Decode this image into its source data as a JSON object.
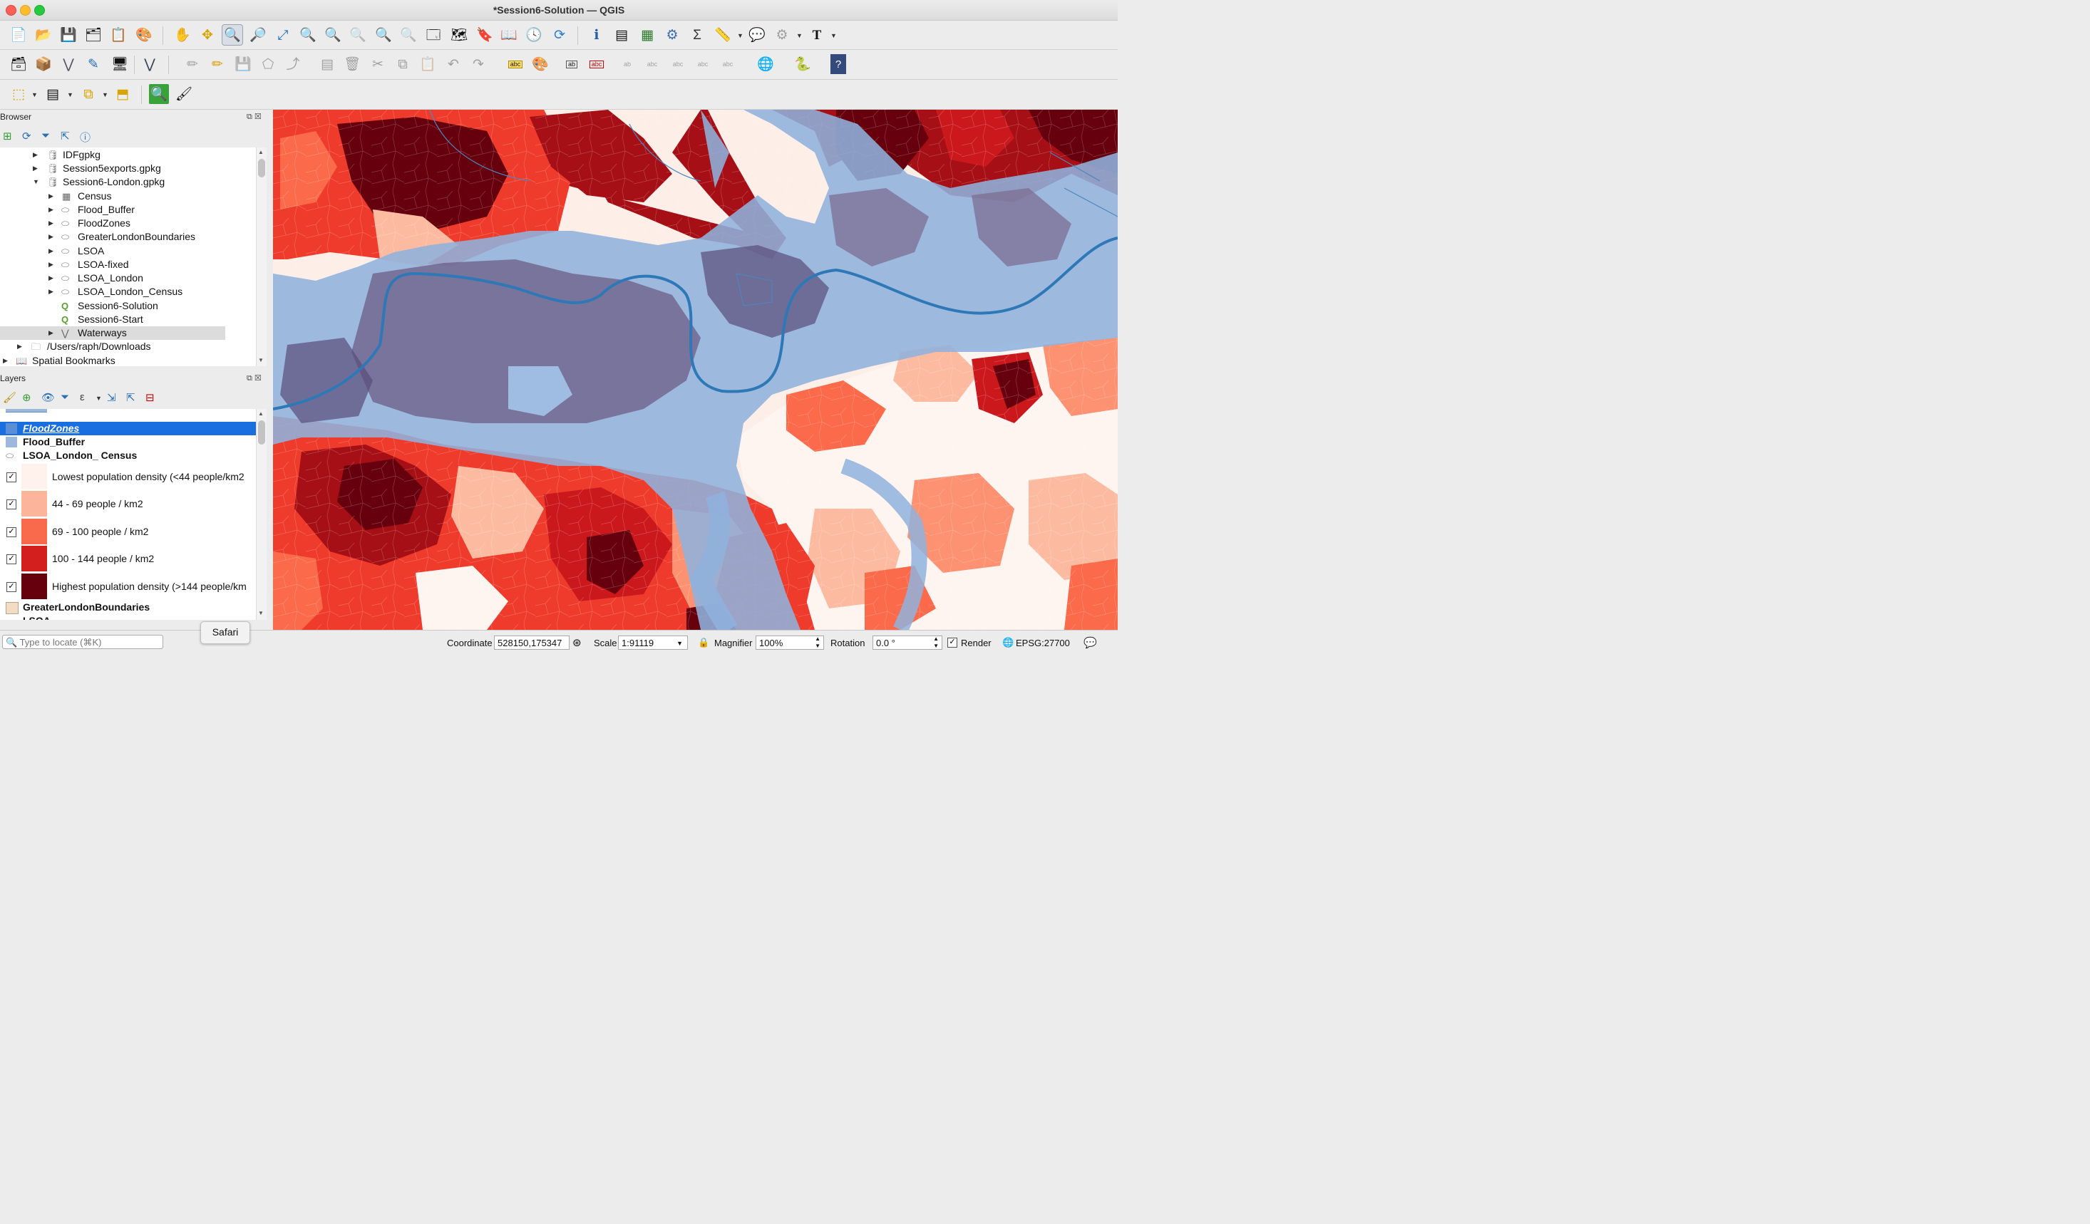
{
  "window": {
    "title": "*Session6-Solution — QGIS"
  },
  "toolbar1": {
    "icons": [
      "new-project-icon",
      "open-project-icon",
      "save-project-icon",
      "save-as-icon",
      "print-layout-icon",
      "style-manager-icon",
      "pan-icon",
      "pan-to-selection-icon",
      "zoom-in-icon",
      "zoom-out-icon",
      "zoom-full-icon",
      "zoom-to-selection-icon",
      "zoom-to-layer-icon",
      "zoom-native-icon",
      "zoom-last-icon",
      "zoom-next-icon",
      "new-map-view-icon",
      "new-3d-view-icon",
      "new-bookmark-icon",
      "show-bookmarks-icon",
      "temporal-controller-icon",
      "refresh-icon",
      "identify-icon",
      "attribute-table-icon",
      "field-calculator-icon",
      "processing-toolbox-icon",
      "statistics-icon",
      "measure-icon",
      "map-tips-icon",
      "settings-icon",
      "text-annotation-icon"
    ]
  },
  "browser": {
    "title": "Browser",
    "items": [
      {
        "label": "IDFgpkg"
      },
      {
        "label": "Session5exports.gpkg"
      },
      {
        "label": "Session6-London.gpkg"
      },
      {
        "label": "Census"
      },
      {
        "label": "Flood_Buffer"
      },
      {
        "label": "FloodZones"
      },
      {
        "label": "GreaterLondonBoundaries"
      },
      {
        "label": "LSOA"
      },
      {
        "label": "LSOA-fixed"
      },
      {
        "label": "LSOA_London"
      },
      {
        "label": "LSOA_London_Census"
      },
      {
        "label": "Session6-Solution"
      },
      {
        "label": "Session6-Start"
      },
      {
        "label": "Waterways"
      },
      {
        "label": "/Users/raph/Downloads"
      },
      {
        "label": "Spatial Bookmarks"
      }
    ]
  },
  "layers": {
    "title": "Layers",
    "items": [
      {
        "label": "FloodZones",
        "color": "#5a8fd6"
      },
      {
        "label": "Flood_Buffer",
        "color": "#9db8dd"
      },
      {
        "label": "LSOA_London_ Census"
      },
      {
        "label": "Lowest population density (<44 people/km2",
        "color": "#fff1ec"
      },
      {
        "label": "44 - 69 people / km2",
        "color": "#fcb49a"
      },
      {
        "label": "69 - 100 people / km2",
        "color": "#f9694c"
      },
      {
        "label": "100 - 144 people / km2",
        "color": "#d3201f"
      },
      {
        "label": "Highest population density (>144 people/km",
        "color": "#67000d"
      },
      {
        "label": "GreaterLondonBoundaries",
        "color": "#f3dcc4"
      },
      {
        "label": "LSOA"
      }
    ]
  },
  "locator": {
    "placeholder": "Type to locate (⌘K)"
  },
  "tooltip": {
    "text": "Safari"
  },
  "statusbar": {
    "coordinate_label": "Coordinate",
    "coordinate_value": "528150,175347",
    "scale_label": "Scale",
    "scale_value": "1:91119",
    "magnifier_label": "Magnifier",
    "magnifier_value": "100%",
    "rotation_label": "Rotation",
    "rotation_value": "0.0 °",
    "render_label": "Render",
    "crs": "EPSG:27700"
  },
  "map": {
    "river_color": "#2e78b7",
    "flood_color": "#8fb2dd"
  }
}
